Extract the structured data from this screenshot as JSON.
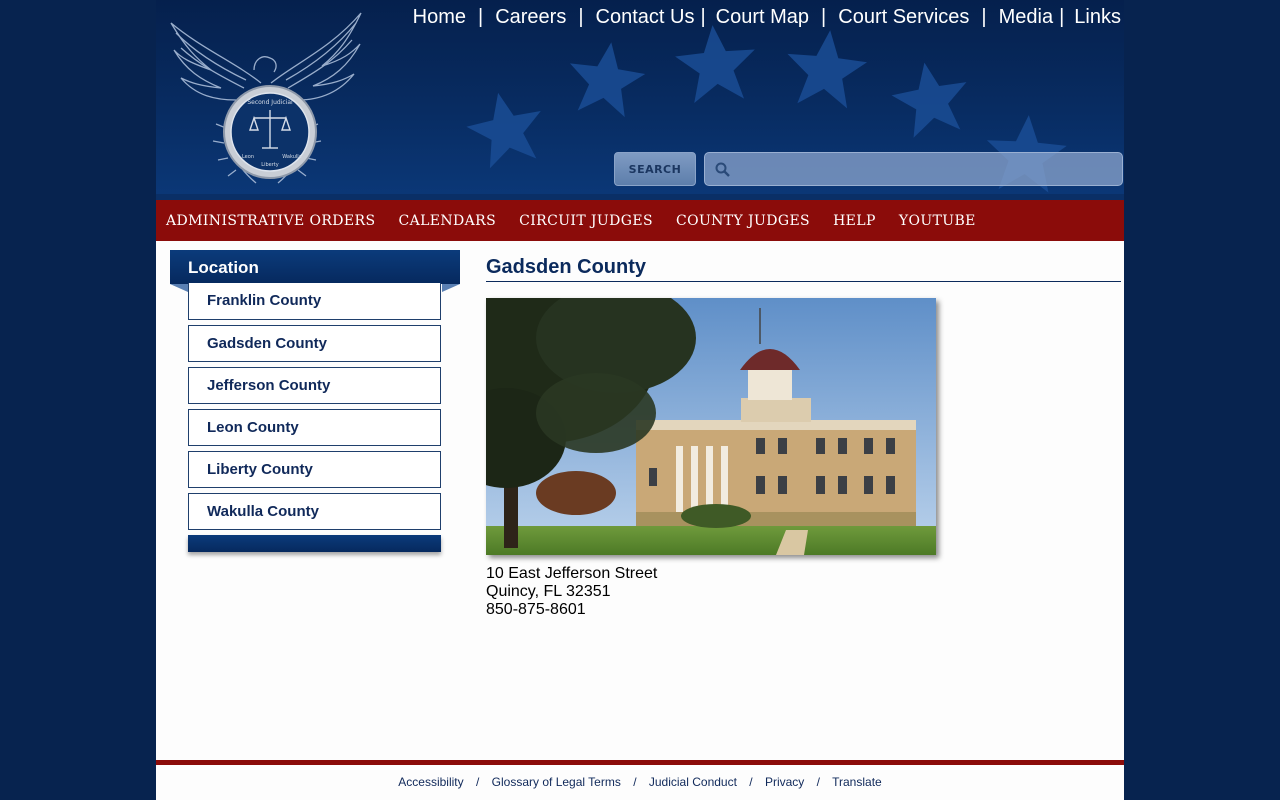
{
  "header": {
    "seal_text": [
      "Florida's Second Judicial Circuit",
      "Franklin",
      "Gadsden",
      "Jefferson",
      "Leon",
      "Liberty",
      "Wakulla"
    ],
    "top_nav": [
      {
        "label": "Home"
      },
      {
        "label": "Careers"
      },
      {
        "label": "Contact Us"
      },
      {
        "label": "Court Map"
      },
      {
        "label": "Court Services"
      },
      {
        "label": "Media"
      },
      {
        "label": "Links"
      }
    ],
    "search": {
      "button_label": "SEARCH",
      "value": "",
      "placeholder": ""
    }
  },
  "main_nav": [
    {
      "label": "ADMINISTRATIVE ORDERS"
    },
    {
      "label": "CALENDARS"
    },
    {
      "label": "CIRCUIT JUDGES"
    },
    {
      "label": "COUNTY JUDGES"
    },
    {
      "label": "HELP"
    },
    {
      "label": "YOUTUBE"
    }
  ],
  "sidebar": {
    "title": "Location",
    "items": [
      {
        "label": "Franklin County"
      },
      {
        "label": "Gadsden County"
      },
      {
        "label": "Jefferson County"
      },
      {
        "label": "Leon County"
      },
      {
        "label": "Liberty County"
      },
      {
        "label": "Wakulla County"
      }
    ]
  },
  "main": {
    "title": "Gadsden County",
    "address_line1": "10 East Jefferson Street",
    "address_line2": "Quincy, FL 32351",
    "phone": "850-875-8601"
  },
  "footer": {
    "links": [
      {
        "label": "Accessibility"
      },
      {
        "label": "Glossary of Legal Terms"
      },
      {
        "label": "Judicial Conduct"
      },
      {
        "label": "Privacy"
      },
      {
        "label": "Translate"
      }
    ]
  },
  "colors": {
    "background": "#07234f",
    "header_navy": "#082c62",
    "nav_red": "#8b0c0a",
    "text_navy": "#0b2a5c"
  },
  "icons": {
    "search": "magnifier-icon",
    "seal": "eagle-seal-icon"
  }
}
